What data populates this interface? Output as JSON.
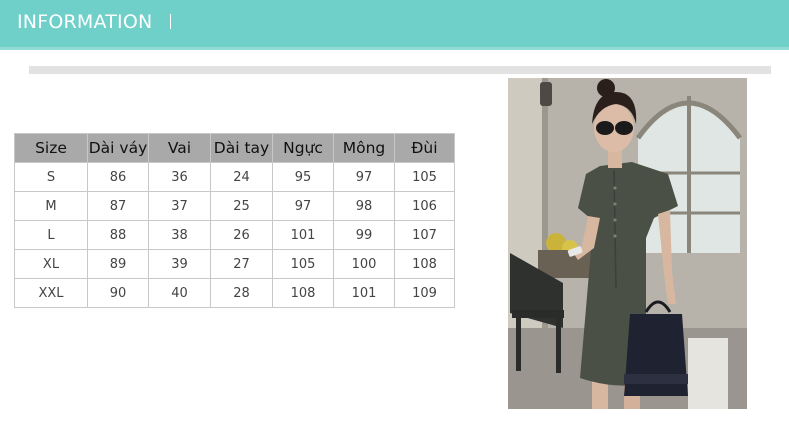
{
  "header": {
    "title": "INFORMATION"
  },
  "size_table": {
    "columns": [
      "Size",
      "Dài váy",
      "Vai",
      "Dài tay",
      "Ngực",
      "Mông",
      "Đùi"
    ],
    "rows": [
      [
        "S",
        "86",
        "36",
        "24",
        "95",
        "97",
        "105"
      ],
      [
        "M",
        "87",
        "37",
        "25",
        "97",
        "98",
        "106"
      ],
      [
        "L",
        "88",
        "38",
        "26",
        "101",
        "99",
        "107"
      ],
      [
        "XL",
        "89",
        "39",
        "27",
        "105",
        "100",
        "108"
      ],
      [
        "XXL",
        "90",
        "40",
        "28",
        "108",
        "101",
        "109"
      ]
    ]
  },
  "colors": {
    "header_band": "#6fcfc9",
    "table_header": "#a9a9a9",
    "dress": "#4a5045"
  }
}
